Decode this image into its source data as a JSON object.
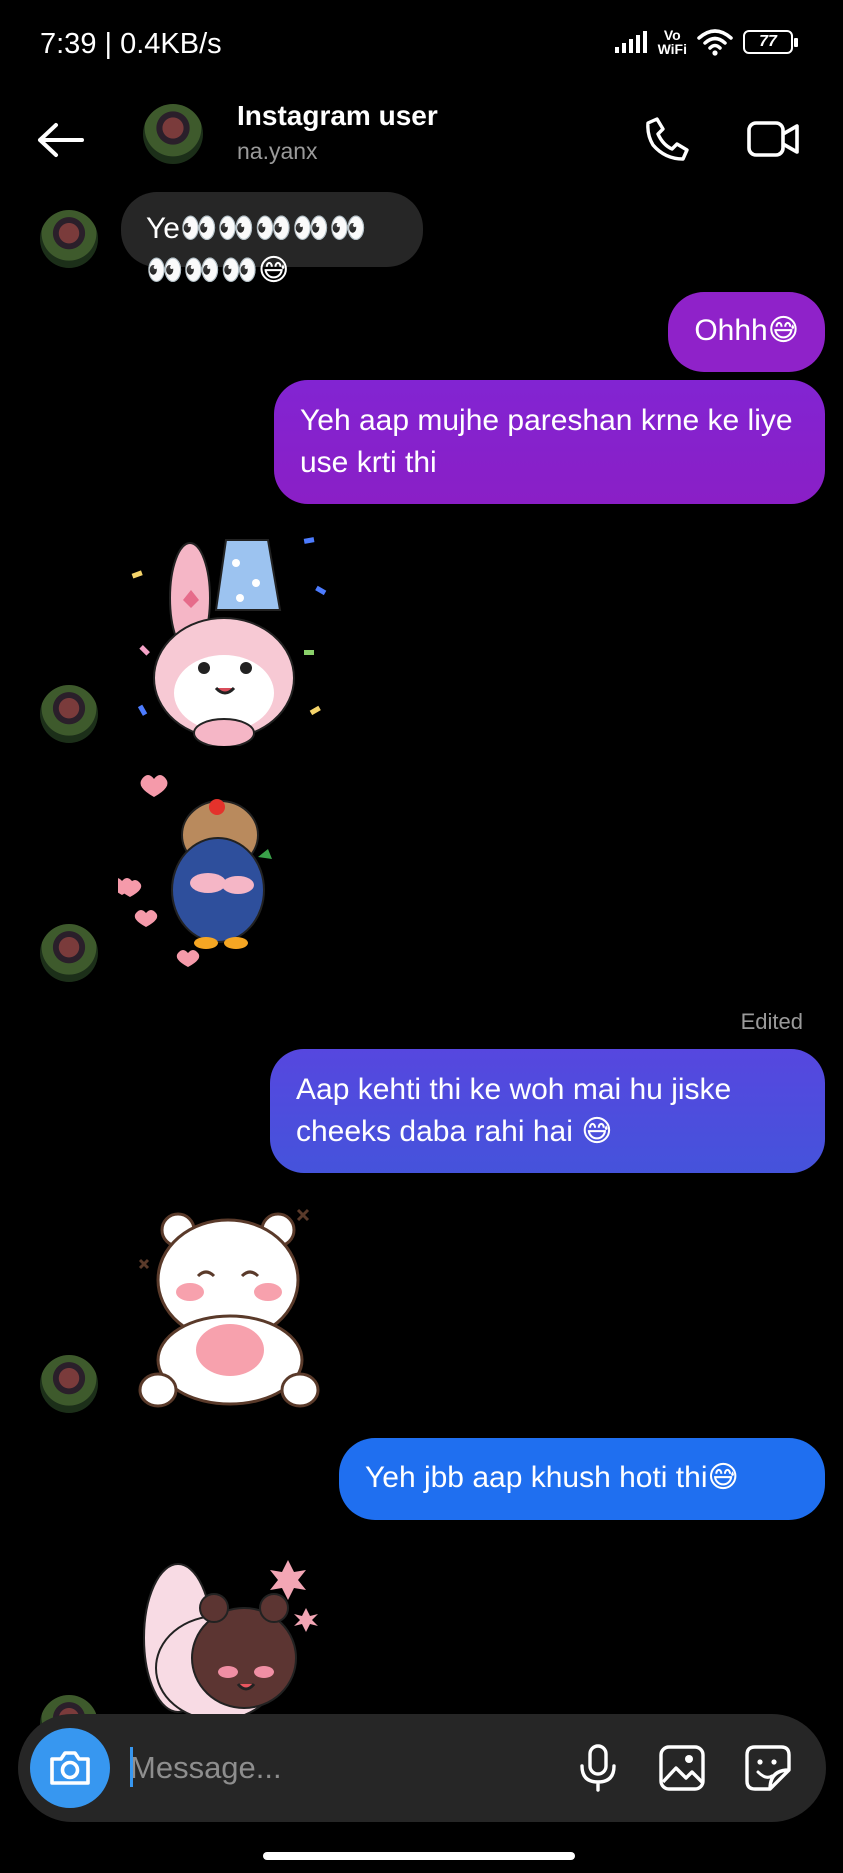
{
  "status_bar": {
    "time": "7:39 | 0.4KB/s",
    "network_badge_line1": "Vo",
    "network_badge_line2": "WiFi",
    "battery": "77"
  },
  "header": {
    "name": "Instagram user",
    "handle": "na.yanx"
  },
  "messages": [
    {
      "direction": "incoming",
      "type": "text",
      "text": "Ye👀👀👀👀👀👀👀👀😅"
    },
    {
      "direction": "outgoing",
      "type": "text",
      "text": "Ohhh😅"
    },
    {
      "direction": "outgoing",
      "type": "text",
      "text": "Yeh aap mujhe pareshan krne ke liye use krti thi"
    },
    {
      "direction": "incoming",
      "type": "sticker",
      "sticker": "pink-bunny-party-hat-sticker"
    },
    {
      "direction": "incoming",
      "type": "sticker",
      "sticker": "blue-penguin-hearts-sticker"
    },
    {
      "direction": "outgoing",
      "type": "text",
      "status": "Edited",
      "text": "Aap kehti thi ke woh mai hu jiske cheeks daba rahi hai 😅"
    },
    {
      "direction": "incoming",
      "type": "sticker",
      "sticker": "white-bear-blushing-sticker"
    },
    {
      "direction": "outgoing",
      "type": "text",
      "text": "Yeh jbb aap khush hoti thi😅"
    },
    {
      "direction": "incoming",
      "type": "sticker",
      "sticker": "bunny-and-bear-hug-sticker"
    }
  ],
  "composer": {
    "placeholder": "Message..."
  },
  "colors": {
    "background": "#000000",
    "incoming_bubble": "#262626",
    "outgoing_purple": "#8f22c9",
    "outgoing_indigo": "#4c50dc",
    "outgoing_blue": "#1f6ff0",
    "camera_button": "#3797f0"
  },
  "icons": [
    "back-arrow-icon",
    "phone-icon",
    "video-camera-icon",
    "camera-icon",
    "microphone-icon",
    "gallery-icon",
    "sticker-icon"
  ]
}
